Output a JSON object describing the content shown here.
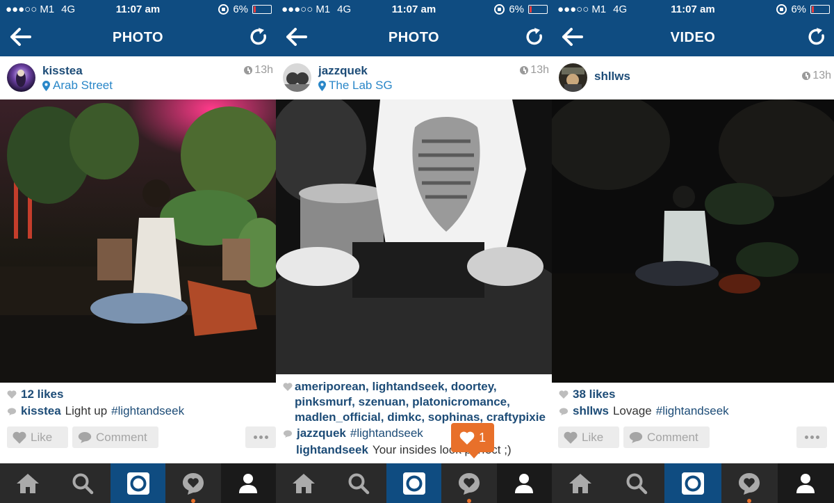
{
  "status_bar": {
    "signal": "●●●○○",
    "carrier": "M1",
    "network": "4G",
    "time": "11:07 am",
    "battery": "6%"
  },
  "colors": {
    "nav": "#0f4c81",
    "link": "#1d4c77",
    "location": "#2a87c8",
    "notification": "#e8702a",
    "battery_low": "#e53b3b"
  },
  "panels": [
    {
      "title": "PHOTO",
      "username": "kisstea",
      "location": "Arab Street",
      "time": "13h",
      "likes": "12 likes",
      "caption_user": "kisstea",
      "caption_text": "Light up",
      "caption_tag": "#lightandseek",
      "like_label": "Like",
      "comment_label": "Comment"
    },
    {
      "title": "PHOTO",
      "username": "jazzquek",
      "location": "The Lab SG",
      "time": "13h",
      "liked_by": "ameriporean, lightandseek, doortey, pinksmurf, szenuan, platonicromance, madlen_official, dimkc, sophinas, craftypixie",
      "caption_user": "jazzquek",
      "caption_tag": "#lightandseek",
      "comment_user": "lightandseek",
      "comment_text": "Your insides look perfect ;)",
      "notification_count": "1"
    },
    {
      "title": "VIDEO",
      "username": "shllws",
      "time": "13h",
      "likes": "38 likes",
      "caption_user": "shllws",
      "caption_text": "Lovage",
      "caption_tag": "#lightandseek",
      "like_label": "Like",
      "comment_label": "Comment"
    }
  ],
  "icons": [
    "back-arrow-icon",
    "refresh-icon",
    "pin-icon",
    "clock-icon",
    "heart-icon",
    "comment-bubble-icon",
    "home-icon",
    "search-icon",
    "camera-icon",
    "activity-icon",
    "profile-icon"
  ]
}
